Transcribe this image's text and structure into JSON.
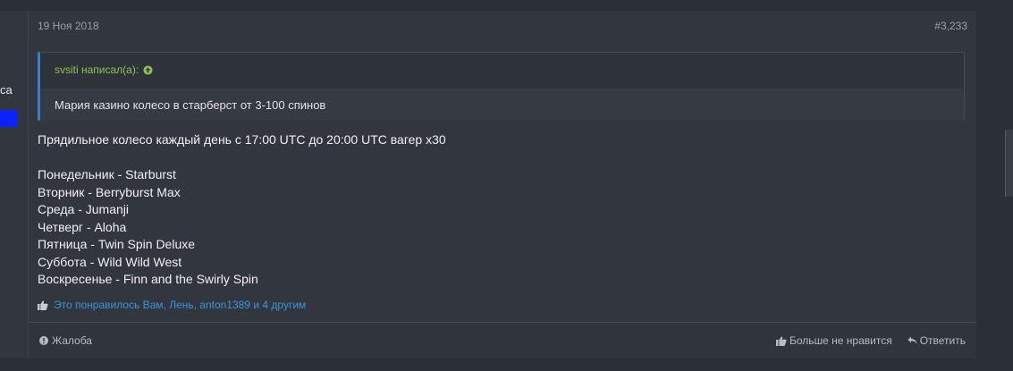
{
  "user": {
    "title_fragment": "са"
  },
  "post": {
    "date": "19 Ноя 2018",
    "number": "#3,233",
    "quote": {
      "author": "svsiti написал(а):",
      "icon": "arrow-up-circle-icon",
      "text": "Мария казино колесо в старберст от 3-100 спинов"
    },
    "message_lines": [
      "Прядильное колесо каждый день с 17:00 UTC до 20:00 UTC вагер х30",
      "",
      "Понедельник - Starburst",
      "Вторник - Berryburst Max",
      "Среда - Jumanji",
      "Четверг - Aloha",
      "Пятница - Twin Spin Deluxe",
      "Суббота - Wild Wild West",
      "Воскресенье - Finn and the Swirly Spin"
    ],
    "likes_text": "Это понравилось Вам, Лень, anton1389 и 4 другим",
    "footer": {
      "report_label": "Жалоба",
      "unlike_label": "Больше не нравится",
      "reply_label": "Ответить"
    }
  },
  "colors": {
    "background": "#2b2f36",
    "panel": "#32363e",
    "quote_accent": "#3d7ec7",
    "quote_author": "#8fc057",
    "link": "#3c94d8",
    "user_banner": "#0a22ff"
  }
}
